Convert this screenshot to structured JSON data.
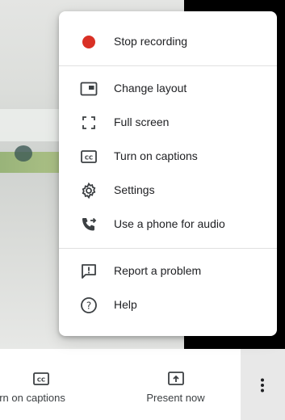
{
  "menu": {
    "items": [
      {
        "label": "Stop recording",
        "icon": "record-dot-icon"
      },
      {
        "label": "Change layout",
        "icon": "layout-icon"
      },
      {
        "label": "Full screen",
        "icon": "fullscreen-icon"
      },
      {
        "label": "Turn on captions",
        "icon": "captions-icon"
      },
      {
        "label": "Settings",
        "icon": "gear-icon"
      },
      {
        "label": "Use a phone for audio",
        "icon": "phone-audio-icon"
      },
      {
        "label": "Report a problem",
        "icon": "report-icon"
      },
      {
        "label": "Help",
        "icon": "help-icon"
      }
    ]
  },
  "bottom_bar": {
    "captions_label": "urn on captions",
    "present_label": "Present now"
  },
  "colors": {
    "record": "#d93025",
    "text": "#202124",
    "icon": "#3c4043"
  }
}
